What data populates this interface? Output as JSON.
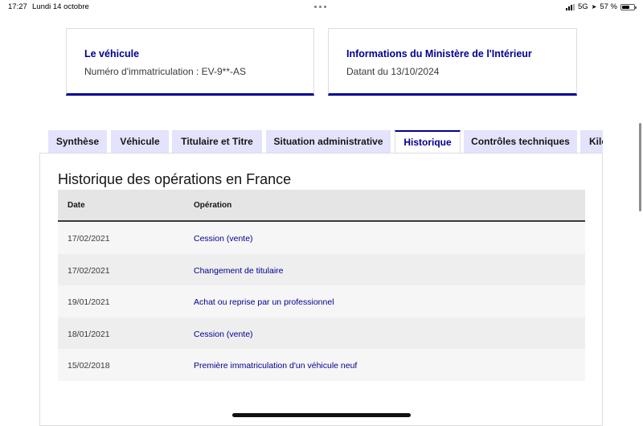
{
  "status_bar": {
    "time": "17:27",
    "date": "Lundi 14 octobre",
    "network": "5G",
    "battery": "57 %"
  },
  "cards": [
    {
      "title": "Le véhicule",
      "subtitle": "Numéro d'immatriculation : EV-9**-AS"
    },
    {
      "title": "Informations du Ministère de l'Intérieur",
      "subtitle": "Datant du 13/10/2024"
    }
  ],
  "tabs": [
    {
      "label": "Synthèse",
      "active": false
    },
    {
      "label": "Véhicule",
      "active": false
    },
    {
      "label": "Titulaire et Titre",
      "active": false
    },
    {
      "label": "Situation administrative",
      "active": false
    },
    {
      "label": "Historique",
      "active": true
    },
    {
      "label": "Contrôles techniques",
      "active": false
    },
    {
      "label": "Kilo",
      "active": false
    }
  ],
  "history": {
    "title": "Historique des opérations en France",
    "columns": [
      "Date",
      "Opération"
    ],
    "rows": [
      {
        "date": "17/02/2021",
        "operation": "Cession (vente)"
      },
      {
        "date": "17/02/2021",
        "operation": "Changement de titulaire"
      },
      {
        "date": "19/01/2021",
        "operation": "Achat ou reprise par un professionnel"
      },
      {
        "date": "18/01/2021",
        "operation": "Cession (vente)"
      },
      {
        "date": "15/02/2018",
        "operation": "Première immatriculation d'un véhicule neuf"
      }
    ]
  },
  "colors": {
    "accent": "#000091",
    "tab_bg": "#e3e3fd"
  }
}
